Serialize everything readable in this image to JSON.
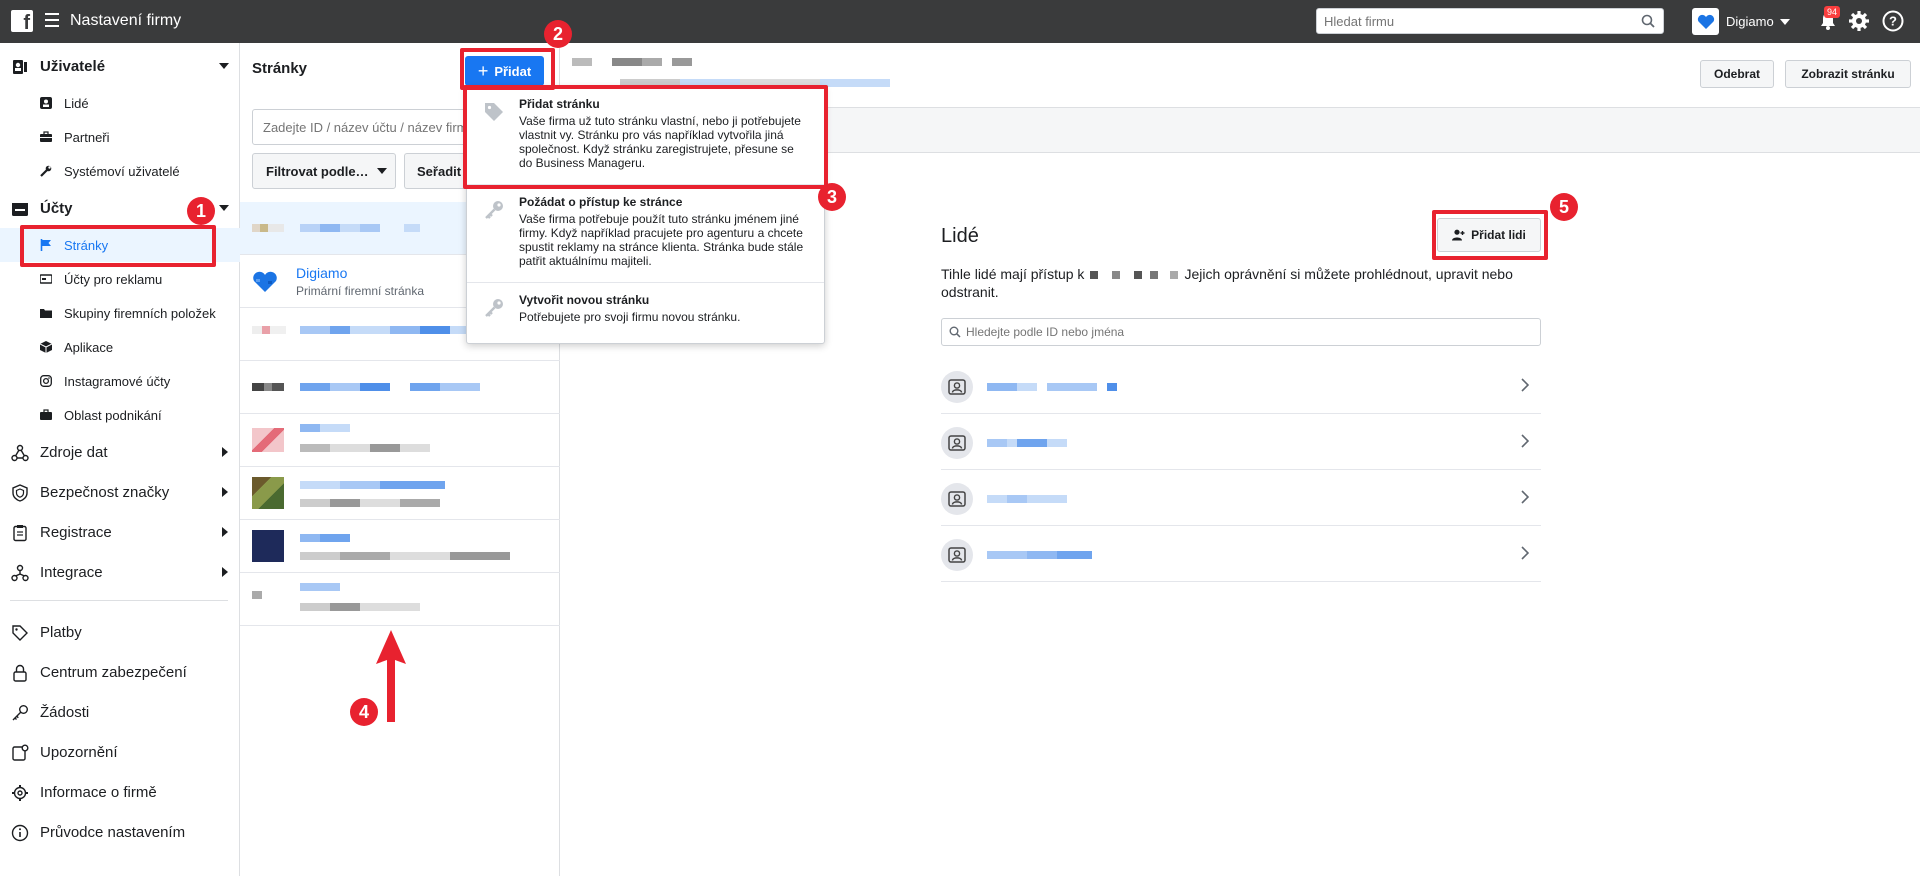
{
  "header": {
    "title": "Nastavení firmy",
    "search_placeholder": "Hledat firmu",
    "business_name": "Digiamo",
    "notification_count": "94"
  },
  "sidebar": {
    "users_section": "Uživatelé",
    "users_items": [
      "Lidé",
      "Partneři",
      "Systémoví uživatelé"
    ],
    "accounts_section": "Účty",
    "accounts_items": [
      "Stránky",
      "Účty pro reklamu",
      "Skupiny firemních položek",
      "Aplikace",
      "Instagramové účty",
      "Oblast podnikání"
    ],
    "main_items": [
      "Zdroje dat",
      "Bezpečnost značky",
      "Registrace",
      "Integrace"
    ],
    "bottom_items": [
      "Platby",
      "Centrum zabezpečení",
      "Žádosti",
      "Upozornění",
      "Informace o firmě",
      "Průvodce nastavením"
    ]
  },
  "pages_panel": {
    "title": "Stránky",
    "add_button": "Přidat",
    "search_placeholder": "Zadejte ID / název účtu / název firmy",
    "filter_button": "Filtrovat podle…",
    "sort_button": "Seřadit",
    "digiamo_name": "Digiamo",
    "digiamo_sub": "Primární firemní stránka"
  },
  "dropdown": {
    "items": [
      {
        "title": "Přidat stránku",
        "desc": "Vaše firma už tuto stránku vlastní, nebo ji potřebujete vlastnit vy. Stránku pro vás například vytvořila jiná společnost. Když stránku zaregistrujete, přesune se do Business Manageru."
      },
      {
        "title": "Požádat o přístup ke stránce",
        "desc": "Vaše firma potřebuje použít tuto stránku jménem jiné firmy. Když například pracujete pro agenturu a chcete spustit reklamy na stránce klienta. Stránka bude stále patřit aktuálnímu majiteli."
      },
      {
        "title": "Vytvořit novou stránku",
        "desc": "Potřebujete pro svoji firmu novou stránku."
      }
    ]
  },
  "page_detail": {
    "remove_button": "Odebrat",
    "view_button": "Zobrazit stránku",
    "people_title": "Lidé",
    "people_desc_before": "Tihle lidé mají přístup k",
    "people_desc_after": "Jejich oprávnění si můžete prohlédnout, upravit nebo odstranit.",
    "add_people_button": "Přidat lidi",
    "people_search_placeholder": "Hledejte podle ID nebo jména"
  },
  "annotations": [
    "1",
    "2",
    "3",
    "4",
    "5"
  ],
  "colors": {
    "topbar": "#3a3b3c",
    "accent": "#1877f2",
    "highlight": "#e8222f"
  }
}
